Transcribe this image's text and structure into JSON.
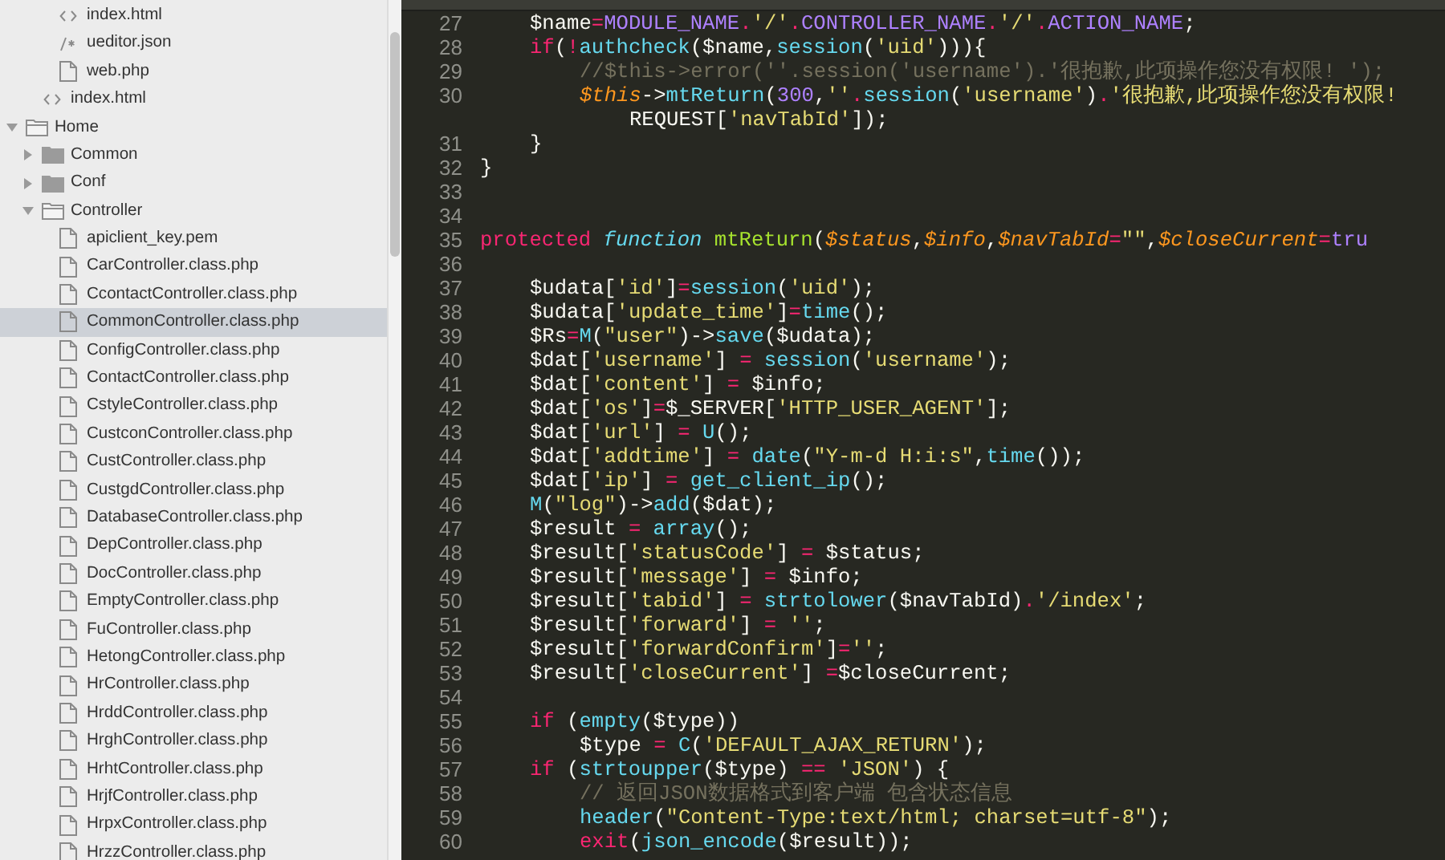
{
  "sidebar": {
    "tree": [
      {
        "children": [
          {
            "children": [
              {
                "name": "index.html",
                "kind": "markup",
                "selected": false
              },
              {
                "name": "ueditor.json",
                "kind": "json",
                "selected": false
              },
              {
                "name": "web.php",
                "kind": "file",
                "selected": false
              }
            ]
          },
          {
            "name": "index.html",
            "kind": "markup",
            "selected": false
          }
        ]
      },
      {
        "name": "Home",
        "kind": "folder",
        "expanded": true,
        "children": [
          {
            "name": "Common",
            "kind": "folder",
            "expanded": false
          },
          {
            "name": "Conf",
            "kind": "folder",
            "expanded": false
          },
          {
            "name": "Controller",
            "kind": "folder",
            "expanded": true,
            "children": [
              {
                "name": "apiclient_key.pem",
                "kind": "file",
                "selected": false
              },
              {
                "name": "CarController.class.php",
                "kind": "file",
                "selected": false
              },
              {
                "name": "CcontactController.class.php",
                "kind": "file",
                "selected": false
              },
              {
                "name": "CommonController.class.php",
                "kind": "file",
                "selected": true
              },
              {
                "name": "ConfigController.class.php",
                "kind": "file",
                "selected": false
              },
              {
                "name": "ContactController.class.php",
                "kind": "file",
                "selected": false
              },
              {
                "name": "CstyleController.class.php",
                "kind": "file",
                "selected": false
              },
              {
                "name": "CustconController.class.php",
                "kind": "file",
                "selected": false
              },
              {
                "name": "CustController.class.php",
                "kind": "file",
                "selected": false
              },
              {
                "name": "CustgdController.class.php",
                "kind": "file",
                "selected": false
              },
              {
                "name": "DatabaseController.class.php",
                "kind": "file",
                "selected": false
              },
              {
                "name": "DepController.class.php",
                "kind": "file",
                "selected": false
              },
              {
                "name": "DocController.class.php",
                "kind": "file",
                "selected": false
              },
              {
                "name": "EmptyController.class.php",
                "kind": "file",
                "selected": false
              },
              {
                "name": "FuController.class.php",
                "kind": "file",
                "selected": false
              },
              {
                "name": "HetongController.class.php",
                "kind": "file",
                "selected": false
              },
              {
                "name": "HrController.class.php",
                "kind": "file",
                "selected": false
              },
              {
                "name": "HrddController.class.php",
                "kind": "file",
                "selected": false
              },
              {
                "name": "HrghController.class.php",
                "kind": "file",
                "selected": false
              },
              {
                "name": "HrhtController.class.php",
                "kind": "file",
                "selected": false
              },
              {
                "name": "HrjfController.class.php",
                "kind": "file",
                "selected": false
              },
              {
                "name": "HrpxController.class.php",
                "kind": "file",
                "selected": false
              },
              {
                "name": "HrzzController.class.php",
                "kind": "file",
                "selected": false
              }
            ]
          }
        ]
      }
    ]
  },
  "editor": {
    "lines": [
      {
        "children": [
          {
            "children": [
              {
                "number": "27",
                "segments": [
                  {
                    "kind": "plain",
                    "text": "$name"
                  },
                  {
                    "kind": "operator",
                    "text": "="
                  },
                  {
                    "kind": "constant",
                    "text": "MODULE_NAME"
                  },
                  {
                    "kind": "operator",
                    "text": "."
                  },
                  {
                    "kind": "string",
                    "text": "'/'"
                  },
                  {
                    "kind": "operator",
                    "text": "."
                  },
                  {
                    "kind": "constant",
                    "text": "CONTROLLER_NAME"
                  },
                  {
                    "kind": "operator",
                    "text": "."
                  },
                  {
                    "kind": "string",
                    "text": "'/'"
                  },
                  {
                    "kind": "operator",
                    "text": "."
                  },
                  {
                    "kind": "constant",
                    "text": "ACTION_NAME"
                  },
                  {
                    "kind": "plain",
                    "text": ";"
                  }
                ]
              },
              {
                "number": "28",
                "segments": [
                  {
                    "kind": "keyword",
                    "text": "if"
                  },
                  {
                    "kind": "plain",
                    "text": "("
                  },
                  {
                    "kind": "operator",
                    "text": "!"
                  },
                  {
                    "kind": "call",
                    "text": "authcheck"
                  },
                  {
                    "kind": "plain",
                    "text": "($name,"
                  },
                  {
                    "kind": "call",
                    "text": "session"
                  },
                  {
                    "kind": "plain",
                    "text": "("
                  },
                  {
                    "kind": "string",
                    "text": "'uid'"
                  },
                  {
                    "kind": "plain",
                    "text": "))){"
                  }
                ]
              },
              {
                "children": [
                  {
                    "number": "29",
                    "segments": [
                      {
                        "kind": "comment",
                        "text": "//$this->error(''.session('username').'很抱歉,此项操作您没有权限! ');"
                      }
                    ]
                  },
                  {
                    "number": "30",
                    "segments": [
                      {
                        "kind": "variable",
                        "text": "$this"
                      },
                      {
                        "kind": "plain",
                        "text": "->"
                      },
                      {
                        "kind": "call",
                        "text": "mtReturn"
                      },
                      {
                        "kind": "plain",
                        "text": "("
                      },
                      {
                        "kind": "constant",
                        "text": "300"
                      },
                      {
                        "kind": "plain",
                        "text": ","
                      },
                      {
                        "kind": "string",
                        "text": "''"
                      },
                      {
                        "kind": "operator",
                        "text": "."
                      },
                      {
                        "kind": "call",
                        "text": "session"
                      },
                      {
                        "kind": "plain",
                        "text": "("
                      },
                      {
                        "kind": "string",
                        "text": "'username'"
                      },
                      {
                        "kind": "plain",
                        "text": ")"
                      },
                      {
                        "kind": "operator",
                        "text": "."
                      },
                      {
                        "kind": "string",
                        "text": "'很抱歉,此项操作您没有权限!"
                      }
                    ],
                    "wrap": [
                      {
                        "kind": "plain",
                        "text": "REQUEST["
                      },
                      {
                        "kind": "string",
                        "text": "'navTabId'"
                      },
                      {
                        "kind": "plain",
                        "text": "]);"
                      }
                    ]
                  }
                ]
              },
              {
                "number": "31",
                "segments": [
                  {
                    "kind": "plain",
                    "text": "}"
                  }
                ]
              }
            ]
          },
          {
            "number": "32",
            "segments": [
              {
                "kind": "plain",
                "text": "}"
              }
            ]
          },
          {
            "number": "33"
          },
          {
            "number": "34"
          },
          {
            "number": "35",
            "segments": [
              {
                "kind": "keyword",
                "text": "protected "
              },
              {
                "kind": "storage",
                "text": "function "
              },
              {
                "kind": "name",
                "text": "mtReturn"
              },
              {
                "kind": "plain",
                "text": "("
              },
              {
                "kind": "variable",
                "text": "$status"
              },
              {
                "kind": "plain",
                "text": ","
              },
              {
                "kind": "variable",
                "text": "$info"
              },
              {
                "kind": "plain",
                "text": ","
              },
              {
                "kind": "variable",
                "text": "$navTabId"
              },
              {
                "kind": "operator",
                "text": "="
              },
              {
                "kind": "string",
                "text": "\"\""
              },
              {
                "kind": "plain",
                "text": ","
              },
              {
                "kind": "variable",
                "text": "$closeCurrent"
              },
              {
                "kind": "operator",
                "text": "="
              },
              {
                "kind": "constant",
                "text": "tru"
              }
            ]
          },
          {
            "number": "36"
          },
          {
            "children": [
              {
                "number": "37",
                "segments": [
                  {
                    "kind": "plain",
                    "text": "$udata["
                  },
                  {
                    "kind": "string",
                    "text": "'id'"
                  },
                  {
                    "kind": "plain",
                    "text": "]"
                  },
                  {
                    "kind": "operator",
                    "text": "="
                  },
                  {
                    "kind": "call",
                    "text": "session"
                  },
                  {
                    "kind": "plain",
                    "text": "("
                  },
                  {
                    "kind": "string",
                    "text": "'uid'"
                  },
                  {
                    "kind": "plain",
                    "text": ");"
                  }
                ]
              },
              {
                "number": "38",
                "segments": [
                  {
                    "kind": "plain",
                    "text": "$udata["
                  },
                  {
                    "kind": "string",
                    "text": "'update_time'"
                  },
                  {
                    "kind": "plain",
                    "text": "]"
                  },
                  {
                    "kind": "operator",
                    "text": "="
                  },
                  {
                    "kind": "call",
                    "text": "time"
                  },
                  {
                    "kind": "plain",
                    "text": "();"
                  }
                ]
              },
              {
                "number": "39",
                "segments": [
                  {
                    "kind": "plain",
                    "text": "$Rs"
                  },
                  {
                    "kind": "operator",
                    "text": "="
                  },
                  {
                    "kind": "call",
                    "text": "M"
                  },
                  {
                    "kind": "plain",
                    "text": "("
                  },
                  {
                    "kind": "string",
                    "text": "\"user\""
                  },
                  {
                    "kind": "plain",
                    "text": ")->"
                  },
                  {
                    "kind": "call",
                    "text": "save"
                  },
                  {
                    "kind": "plain",
                    "text": "($udata);"
                  }
                ]
              },
              {
                "number": "40",
                "segments": [
                  {
                    "kind": "plain",
                    "text": "$dat["
                  },
                  {
                    "kind": "string",
                    "text": "'username'"
                  },
                  {
                    "kind": "plain",
                    "text": "] "
                  },
                  {
                    "kind": "operator",
                    "text": "= "
                  },
                  {
                    "kind": "call",
                    "text": "session"
                  },
                  {
                    "kind": "plain",
                    "text": "("
                  },
                  {
                    "kind": "string",
                    "text": "'username'"
                  },
                  {
                    "kind": "plain",
                    "text": ");"
                  }
                ]
              },
              {
                "number": "41",
                "segments": [
                  {
                    "kind": "plain",
                    "text": "$dat["
                  },
                  {
                    "kind": "string",
                    "text": "'content'"
                  },
                  {
                    "kind": "plain",
                    "text": "] "
                  },
                  {
                    "kind": "operator",
                    "text": "="
                  },
                  {
                    "kind": "plain",
                    "text": " $info;"
                  }
                ]
              },
              {
                "number": "42",
                "segments": [
                  {
                    "kind": "plain",
                    "text": "$dat["
                  },
                  {
                    "kind": "string",
                    "text": "'os'"
                  },
                  {
                    "kind": "plain",
                    "text": "]"
                  },
                  {
                    "kind": "operator",
                    "text": "="
                  },
                  {
                    "kind": "plain",
                    "text": "$_SERVER["
                  },
                  {
                    "kind": "string",
                    "text": "'HTTP_USER_AGENT'"
                  },
                  {
                    "kind": "plain",
                    "text": "];"
                  }
                ]
              },
              {
                "number": "43",
                "segments": [
                  {
                    "kind": "plain",
                    "text": "$dat["
                  },
                  {
                    "kind": "string",
                    "text": "'url'"
                  },
                  {
                    "kind": "plain",
                    "text": "] "
                  },
                  {
                    "kind": "operator",
                    "text": "= "
                  },
                  {
                    "kind": "call",
                    "text": "U"
                  },
                  {
                    "kind": "plain",
                    "text": "();"
                  }
                ]
              },
              {
                "number": "44",
                "segments": [
                  {
                    "kind": "plain",
                    "text": "$dat["
                  },
                  {
                    "kind": "string",
                    "text": "'addtime'"
                  },
                  {
                    "kind": "plain",
                    "text": "] "
                  },
                  {
                    "kind": "operator",
                    "text": "= "
                  },
                  {
                    "kind": "call",
                    "text": "date"
                  },
                  {
                    "kind": "plain",
                    "text": "("
                  },
                  {
                    "kind": "string",
                    "text": "\"Y-m-d H:i:s\""
                  },
                  {
                    "kind": "plain",
                    "text": ","
                  },
                  {
                    "kind": "call",
                    "text": "time"
                  },
                  {
                    "kind": "plain",
                    "text": "());"
                  }
                ]
              },
              {
                "number": "45",
                "segments": [
                  {
                    "kind": "plain",
                    "text": "$dat["
                  },
                  {
                    "kind": "string",
                    "text": "'ip'"
                  },
                  {
                    "kind": "plain",
                    "text": "] "
                  },
                  {
                    "kind": "operator",
                    "text": "= "
                  },
                  {
                    "kind": "call",
                    "text": "get_client_ip"
                  },
                  {
                    "kind": "plain",
                    "text": "();"
                  }
                ]
              },
              {
                "number": "46",
                "segments": [
                  {
                    "kind": "call",
                    "text": "M"
                  },
                  {
                    "kind": "plain",
                    "text": "("
                  },
                  {
                    "kind": "string",
                    "text": "\"log\""
                  },
                  {
                    "kind": "plain",
                    "text": ")->"
                  },
                  {
                    "kind": "call",
                    "text": "add"
                  },
                  {
                    "kind": "plain",
                    "text": "($dat);"
                  }
                ]
              },
              {
                "number": "47",
                "segments": [
                  {
                    "kind": "plain",
                    "text": "$result "
                  },
                  {
                    "kind": "operator",
                    "text": "= "
                  },
                  {
                    "kind": "call",
                    "text": "array"
                  },
                  {
                    "kind": "plain",
                    "text": "();"
                  }
                ]
              },
              {
                "number": "48",
                "segments": [
                  {
                    "kind": "plain",
                    "text": "$result["
                  },
                  {
                    "kind": "string",
                    "text": "'statusCode'"
                  },
                  {
                    "kind": "plain",
                    "text": "] "
                  },
                  {
                    "kind": "operator",
                    "text": "="
                  },
                  {
                    "kind": "plain",
                    "text": " $status;"
                  }
                ]
              },
              {
                "number": "49",
                "segments": [
                  {
                    "kind": "plain",
                    "text": "$result["
                  },
                  {
                    "kind": "string",
                    "text": "'message'"
                  },
                  {
                    "kind": "plain",
                    "text": "] "
                  },
                  {
                    "kind": "operator",
                    "text": "="
                  },
                  {
                    "kind": "plain",
                    "text": " $info;"
                  }
                ]
              },
              {
                "number": "50",
                "segments": [
                  {
                    "kind": "plain",
                    "text": "$result["
                  },
                  {
                    "kind": "string",
                    "text": "'tabid'"
                  },
                  {
                    "kind": "plain",
                    "text": "] "
                  },
                  {
                    "kind": "operator",
                    "text": "= "
                  },
                  {
                    "kind": "call",
                    "text": "strtolower"
                  },
                  {
                    "kind": "plain",
                    "text": "($navTabId)"
                  },
                  {
                    "kind": "operator",
                    "text": "."
                  },
                  {
                    "kind": "string",
                    "text": "'/index'"
                  },
                  {
                    "kind": "plain",
                    "text": ";"
                  }
                ]
              },
              {
                "number": "51",
                "segments": [
                  {
                    "kind": "plain",
                    "text": "$result["
                  },
                  {
                    "kind": "string",
                    "text": "'forward'"
                  },
                  {
                    "kind": "plain",
                    "text": "] "
                  },
                  {
                    "kind": "operator",
                    "text": "= "
                  },
                  {
                    "kind": "string",
                    "text": "''"
                  },
                  {
                    "kind": "plain",
                    "text": ";"
                  }
                ]
              },
              {
                "number": "52",
                "segments": [
                  {
                    "kind": "plain",
                    "text": "$result["
                  },
                  {
                    "kind": "string",
                    "text": "'forwardConfirm'"
                  },
                  {
                    "kind": "plain",
                    "text": "]"
                  },
                  {
                    "kind": "operator",
                    "text": "="
                  },
                  {
                    "kind": "string",
                    "text": "''"
                  },
                  {
                    "kind": "plain",
                    "text": ";"
                  }
                ]
              },
              {
                "number": "53",
                "segments": [
                  {
                    "kind": "plain",
                    "text": "$result["
                  },
                  {
                    "kind": "string",
                    "text": "'closeCurrent'"
                  },
                  {
                    "kind": "plain",
                    "text": "] "
                  },
                  {
                    "kind": "operator",
                    "text": "="
                  },
                  {
                    "kind": "plain",
                    "text": "$closeCurrent;"
                  }
                ]
              },
              {
                "number": "54"
              },
              {
                "number": "55",
                "segments": [
                  {
                    "kind": "keyword",
                    "text": "if"
                  },
                  {
                    "kind": "plain",
                    "text": " ("
                  },
                  {
                    "kind": "call",
                    "text": "empty"
                  },
                  {
                    "kind": "plain",
                    "text": "($type))"
                  }
                ]
              },
              {
                "children": [
                  {
                    "number": "56",
                    "segments": [
                      {
                        "kind": "plain",
                        "text": "$type "
                      },
                      {
                        "kind": "operator",
                        "text": "= "
                      },
                      {
                        "kind": "call",
                        "text": "C"
                      },
                      {
                        "kind": "plain",
                        "text": "("
                      },
                      {
                        "kind": "string",
                        "text": "'DEFAULT_AJAX_RETURN'"
                      },
                      {
                        "kind": "plain",
                        "text": ");"
                      }
                    ]
                  }
                ]
              },
              {
                "number": "57",
                "segments": [
                  {
                    "kind": "keyword",
                    "text": "if"
                  },
                  {
                    "kind": "plain",
                    "text": " ("
                  },
                  {
                    "kind": "call",
                    "text": "strtoupper"
                  },
                  {
                    "kind": "plain",
                    "text": "($type) "
                  },
                  {
                    "kind": "operator",
                    "text": "== "
                  },
                  {
                    "kind": "string",
                    "text": "'JSON'"
                  },
                  {
                    "kind": "plain",
                    "text": ") {"
                  }
                ]
              },
              {
                "children": [
                  {
                    "number": "58",
                    "segments": [
                      {
                        "kind": "comment",
                        "text": "// 返回JSON数据格式到客户端 包含状态信息"
                      }
                    ]
                  },
                  {
                    "number": "59",
                    "segments": [
                      {
                        "kind": "call",
                        "text": "header"
                      },
                      {
                        "kind": "plain",
                        "text": "("
                      },
                      {
                        "kind": "string",
                        "text": "\"Content-Type:text/html; charset=utf-8\""
                      },
                      {
                        "kind": "plain",
                        "text": ");"
                      }
                    ]
                  },
                  {
                    "number": "60",
                    "segments": [
                      {
                        "kind": "keyword",
                        "text": "exit"
                      },
                      {
                        "kind": "plain",
                        "text": "("
                      },
                      {
                        "kind": "call",
                        "text": "json_encode"
                      },
                      {
                        "kind": "plain",
                        "text": "($result));"
                      }
                    ]
                  }
                ]
              }
            ]
          }
        ]
      }
    ]
  }
}
